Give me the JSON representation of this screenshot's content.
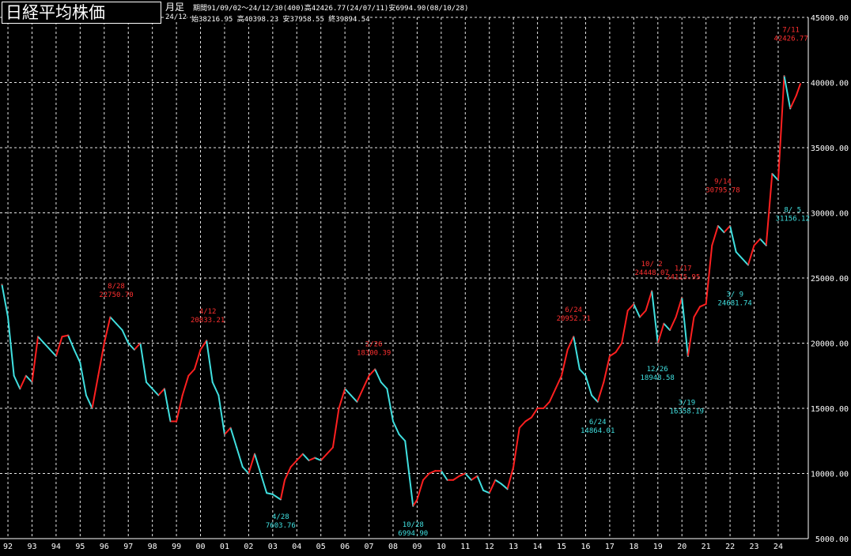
{
  "header": {
    "title": "日経平均株価",
    "period_label": "月足",
    "stats_line": "期間91/09/02〜24/12/30(400)高42426.77(24/07/11)安6994.90(08/10/28)",
    "ohlc_date": "24/12",
    "ohlc_line": "始38216.95 高40398.23 安37958.55 終39894.54"
  },
  "colors": {
    "background": "#000000",
    "grid": "#ffffff",
    "up": "#ff2020",
    "down": "#40e0e0",
    "label_high": "#ff3030",
    "label_low": "#40e0e0",
    "axis_text": "#ffffff"
  },
  "chart_data": {
    "type": "line",
    "title": "日経平均株価",
    "x_range": [
      1991.67,
      2025.25
    ],
    "ylim": [
      5000,
      45000
    ],
    "y_ticks": [
      "5000.00",
      "10000.00",
      "15000.00",
      "20000.00",
      "25000.00",
      "30000.00",
      "35000.00",
      "40000.00",
      "45000.00"
    ],
    "x_ticks": [
      "92",
      "93",
      "94",
      "95",
      "96",
      "97",
      "98",
      "99",
      "00",
      "01",
      "02",
      "03",
      "04",
      "05",
      "06",
      "07",
      "08",
      "09",
      "10",
      "11",
      "12",
      "13",
      "14",
      "15",
      "16",
      "17",
      "18",
      "19",
      "20",
      "21",
      "22",
      "23",
      "24"
    ],
    "grid": true,
    "legend": "none",
    "series": [
      {
        "x": [
          1991.75,
          1992.0,
          1992.25,
          1992.5,
          1992.75,
          1993.0,
          1993.25,
          1993.5,
          1993.75,
          1994.0,
          1994.25,
          1994.5,
          1994.75,
          1995.0,
          1995.25,
          1995.5,
          1995.75,
          1996.0,
          1996.25,
          1996.5,
          1996.75,
          1997.0,
          1997.25,
          1997.5,
          1997.75,
          1998.0,
          1998.25,
          1998.5,
          1998.75,
          1999.0,
          1999.25,
          1999.5,
          1999.75,
          2000.0,
          2000.25,
          2000.5,
          2000.75,
          2001.0,
          2001.25,
          2001.5,
          2001.75,
          2002.0,
          2002.25,
          2002.5,
          2002.75,
          2003.0,
          2003.33,
          2003.5,
          2003.75,
          2004.0,
          2004.25,
          2004.5,
          2004.75,
          2005.0,
          2005.25,
          2005.5,
          2005.75,
          2006.0,
          2006.25,
          2006.5,
          2006.75,
          2007.0,
          2007.25,
          2007.5,
          2007.75,
          2008.0,
          2008.25,
          2008.5,
          2008.83,
          2009.0,
          2009.25,
          2009.5,
          2009.75,
          2010.0,
          2010.25,
          2010.5,
          2010.75,
          2011.0,
          2011.25,
          2011.5,
          2011.75,
          2012.0,
          2012.25,
          2012.5,
          2012.75,
          2013.0,
          2013.25,
          2013.5,
          2013.75,
          2014.0,
          2014.25,
          2014.5,
          2014.75,
          2015.0,
          2015.25,
          2015.5,
          2015.75,
          2016.0,
          2016.25,
          2016.5,
          2016.75,
          2017.0,
          2017.25,
          2017.5,
          2017.75,
          2018.0,
          2018.25,
          2018.5,
          2018.75,
          2019.0,
          2019.25,
          2019.5,
          2019.75,
          2020.0,
          2020.25,
          2020.5,
          2020.75,
          2021.0,
          2021.25,
          2021.5,
          2021.75,
          2022.0,
          2022.25,
          2022.5,
          2022.75,
          2023.0,
          2023.25,
          2023.5,
          2023.75,
          2024.0,
          2024.25,
          2024.5,
          2024.75,
          2024.92
        ],
        "y": [
          24500,
          22000,
          17500,
          16500,
          17500,
          17000,
          20500,
          20000,
          19500,
          19000,
          20500,
          20600,
          19500,
          18500,
          16000,
          15000,
          17500,
          20000,
          22000,
          21500,
          21000,
          20000,
          19500,
          20000,
          17000,
          16500,
          16000,
          16500,
          14000,
          14000,
          16000,
          17500,
          18000,
          19500,
          20200,
          17000,
          16000,
          13000,
          13500,
          12000,
          10500,
          10000,
          11500,
          10000,
          8500,
          8400,
          8000,
          9500,
          10500,
          11000,
          11500,
          11000,
          11200,
          11000,
          11500,
          12000,
          15000,
          16500,
          16000,
          15500,
          16500,
          17500,
          18000,
          17000,
          16500,
          14000,
          13000,
          12500,
          7500,
          8000,
          9500,
          10000,
          10200,
          10200,
          9500,
          9500,
          9800,
          10000,
          9500,
          9800,
          8700,
          8500,
          9500,
          9200,
          8800,
          10500,
          13500,
          14000,
          14300,
          15000,
          15000,
          15500,
          16500,
          17500,
          19500,
          20500,
          18000,
          17500,
          16000,
          15500,
          17000,
          19000,
          19300,
          20000,
          22500,
          23000,
          22000,
          22500,
          24000,
          20000,
          21500,
          21000,
          22000,
          23500,
          19000,
          22000,
          22800,
          23000,
          27500,
          29000,
          28500,
          29000,
          27000,
          26500,
          26000,
          27500,
          28000,
          27500,
          33000,
          32500,
          40500,
          38000,
          39000,
          39894.54
        ]
      }
    ],
    "annotations": [
      {
        "date": "8/28",
        "value": "22750.70",
        "x": 1996.5,
        "y": 22750.7,
        "kind": "high"
      },
      {
        "date": "4/12",
        "value": "20833.21",
        "x": 2000.3,
        "y": 20833.21,
        "kind": "high"
      },
      {
        "date": "2/26",
        "value": "18300.39",
        "x": 2007.2,
        "y": 18300.39,
        "kind": "high"
      },
      {
        "date": "6/24",
        "value": "20952.71",
        "x": 2015.5,
        "y": 20952.71,
        "kind": "high"
      },
      {
        "date": "10/ 2",
        "value": "24448.07",
        "x": 2018.75,
        "y": 24448.07,
        "kind": "high"
      },
      {
        "date": "1/17",
        "value": "24115.95",
        "x": 2020.05,
        "y": 24115.95,
        "kind": "high"
      },
      {
        "date": "9/14",
        "value": "30795.78",
        "x": 2021.7,
        "y": 30795.78,
        "kind": "high"
      },
      {
        "date": "7/11",
        "value": "42426.77",
        "x": 2024.53,
        "y": 42426.77,
        "kind": "high"
      },
      {
        "date": "4/28",
        "value": "7603.76",
        "x": 2003.33,
        "y": 7603.76,
        "kind": "low"
      },
      {
        "date": "10/28",
        "value": "6994.90",
        "x": 2008.83,
        "y": 6994.9,
        "kind": "low"
      },
      {
        "date": "6/24",
        "value": "14864.01",
        "x": 2016.5,
        "y": 14864.01,
        "kind": "low"
      },
      {
        "date": "12/26",
        "value": "18948.58",
        "x": 2018.98,
        "y": 18948.58,
        "kind": "low"
      },
      {
        "date": "3/19",
        "value": "16358.19",
        "x": 2020.2,
        "y": 16358.19,
        "kind": "low"
      },
      {
        "date": "3/ 9",
        "value": "24681.74",
        "x": 2022.2,
        "y": 24681.74,
        "kind": "low"
      },
      {
        "date": "8/ 5",
        "value": "31156.12",
        "x": 2024.6,
        "y": 31156.12,
        "kind": "low"
      }
    ]
  }
}
